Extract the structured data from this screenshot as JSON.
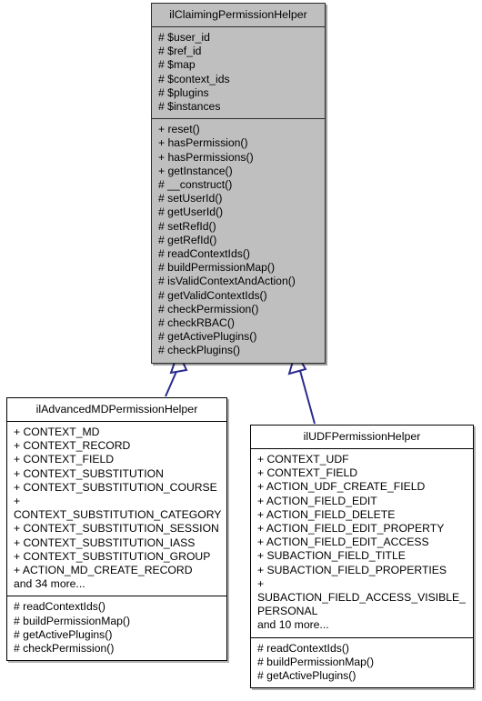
{
  "diagram": {
    "kind": "uml-class-inheritance",
    "edge_color": "#2b2b8f",
    "base_fill": "#bfbfbf",
    "subclass_fill": "#ffffff",
    "border_color": "#000000"
  },
  "classes": {
    "root": {
      "name": "ilClaimingPermissionHelper",
      "attributes": [
        "# $user_id",
        "# $ref_id",
        "# $map",
        "# $context_ids",
        "# $plugins",
        "# $instances"
      ],
      "operations": [
        "+ reset()",
        "+ hasPermission()",
        "+ hasPermissions()",
        "+ getInstance()",
        "# __construct()",
        "# setUserId()",
        "# getUserId()",
        "# setRefId()",
        "# getRefId()",
        "# readContextIds()",
        "# buildPermissionMap()",
        "# isValidContextAndAction()",
        "# getValidContextIds()",
        "# checkPermission()",
        "# checkRBAC()",
        "# getActivePlugins()",
        "# checkPlugins()"
      ]
    },
    "advanced": {
      "name": "ilAdvancedMDPermissionHelper",
      "attributes": [
        "+ CONTEXT_MD",
        "+ CONTEXT_RECORD",
        "+ CONTEXT_FIELD",
        "+ CONTEXT_SUBSTITUTION",
        "+ CONTEXT_SUBSTITUTION_COURSE",
        "+ CONTEXT_SUBSTITUTION_CATEGORY",
        "+ CONTEXT_SUBSTITUTION_SESSION",
        "+ CONTEXT_SUBSTITUTION_IASS",
        "+ CONTEXT_SUBSTITUTION_GROUP",
        "+ ACTION_MD_CREATE_RECORD"
      ],
      "attributes_more": "and 34 more...",
      "operations": [
        "# readContextIds()",
        "# buildPermissionMap()",
        "# getActivePlugins()",
        "# checkPermission()"
      ]
    },
    "udf": {
      "name": "ilUDFPermissionHelper",
      "attributes": [
        "+ CONTEXT_UDF",
        "+ CONTEXT_FIELD",
        "+ ACTION_UDF_CREATE_FIELD",
        "+ ACTION_FIELD_EDIT",
        "+ ACTION_FIELD_DELETE",
        "+ ACTION_FIELD_EDIT_PROPERTY",
        "+ ACTION_FIELD_EDIT_ACCESS",
        "+ SUBACTION_FIELD_TITLE",
        "+ SUBACTION_FIELD_PROPERTIES",
        "+ SUBACTION_FIELD_ACCESS_VISIBLE_PERSONAL"
      ],
      "attributes_more": "and 10 more...",
      "operations": [
        "# readContextIds()",
        "# buildPermissionMap()",
        "# getActivePlugins()"
      ]
    }
  },
  "edges": [
    {
      "from": "ilAdvancedMDPermissionHelper",
      "to": "ilClaimingPermissionHelper",
      "type": "generalization"
    },
    {
      "from": "ilUDFPermissionHelper",
      "to": "ilClaimingPermissionHelper",
      "type": "generalization"
    }
  ]
}
